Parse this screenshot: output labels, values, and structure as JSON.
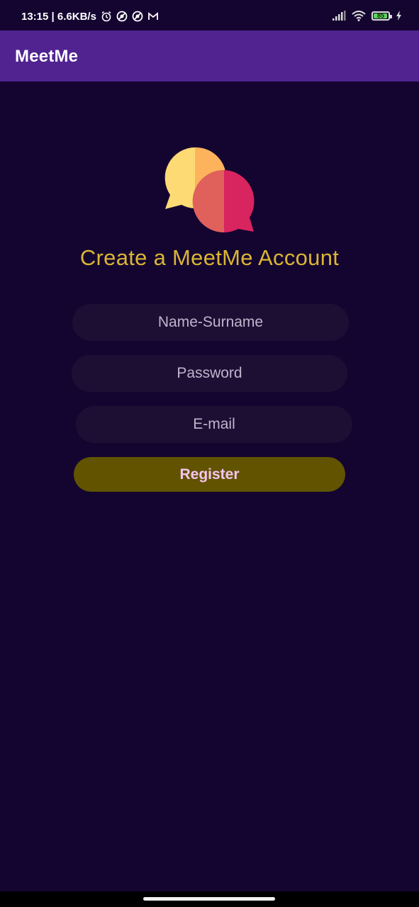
{
  "status_bar": {
    "time_speed": "13:15 | 6.6KB/s",
    "battery": "85",
    "icons": [
      "alarm-icon",
      "vpn-icon",
      "vpn-icon",
      "mail-icon",
      "signal-icon",
      "wifi-icon",
      "battery-icon",
      "charging-icon"
    ]
  },
  "app_bar": {
    "title": "MeetMe"
  },
  "logo": {
    "icon": "chat-bubbles-icon",
    "colors": [
      "#FEDA75",
      "#FDB35B",
      "#E0605C",
      "#D8245F"
    ]
  },
  "form": {
    "heading": "Create a MeetMe Account",
    "name_placeholder": "Name-Surname",
    "password_placeholder": "Password",
    "email_placeholder": "E-mail",
    "register_label": "Register"
  },
  "colors": {
    "background": "#140430",
    "app_bar": "#502391",
    "heading": "#D9B634",
    "button": "#615300",
    "button_text": "#F5C5F0"
  }
}
